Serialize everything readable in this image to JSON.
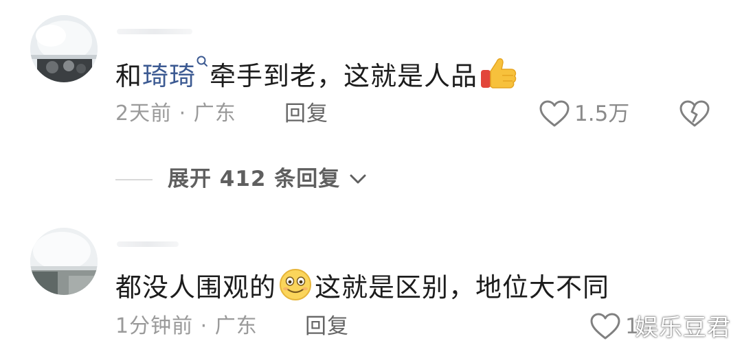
{
  "comments": [
    {
      "text_prefix": "和",
      "mention": "琦琦",
      "text_suffix": "牵手到老，这就是人品",
      "emoji": "thumbs-up",
      "time": "2天前",
      "separator": "·",
      "location": "广东",
      "reply_label": "回复",
      "like_count": "1.5万"
    },
    {
      "text_prefix": "都没人围观的",
      "emoji": "smiling-face",
      "text_suffix": "这就是区别，地位大不同",
      "time": "1分钟前",
      "separator": "·",
      "location": "广东",
      "reply_label": "回复",
      "like_count": "1"
    }
  ],
  "expand_replies": {
    "label": "展开 412 条回复"
  },
  "watermark": "娱乐豆君",
  "colors": {
    "mention": "#3c5a92",
    "meta": "#9a9a9a",
    "text": "#1c1c1c"
  }
}
